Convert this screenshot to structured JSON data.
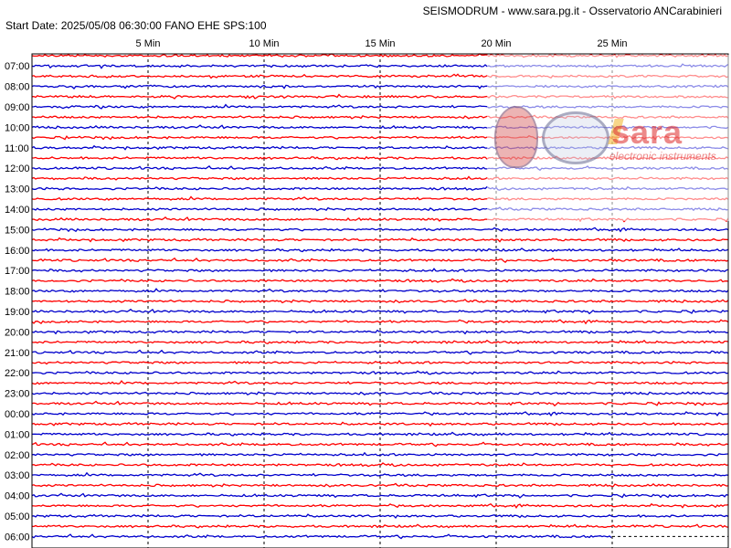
{
  "header": {
    "title": "SEISMODRUM - www.sara.pg.it - Osservatorio ANCarabinieri",
    "start_line": "Start Date: 2025/05/08 06:30:00 FANO   EHE  SPS:100"
  },
  "watermark": {
    "logo_text": "sara",
    "logo_sub": "electronic instruments"
  },
  "colors": {
    "trace_a": "#ff0000",
    "trace_b": "#0000cc",
    "grid": "#000000",
    "frame": "#000000"
  },
  "chart_data": {
    "type": "line",
    "title": "",
    "xlabel": "",
    "ylabel": "",
    "x_ticks": [
      "5 Min",
      "10 Min",
      "15 Min",
      "20 Min",
      "25 Min"
    ],
    "x_tick_minutes": [
      5,
      10,
      15,
      20,
      25
    ],
    "x_range_minutes": [
      0,
      30
    ],
    "rows_per_hour": 2,
    "hour_labels": [
      "07:00",
      "08:00",
      "09:00",
      "10:00",
      "11:00",
      "12:00",
      "13:00",
      "14:00",
      "15:00",
      "16:00",
      "17:00",
      "18:00",
      "19:00",
      "20:00",
      "21:00",
      "22:00",
      "23:00",
      "00:00",
      "01:00",
      "02:00",
      "03:00",
      "04:00",
      "05:00",
      "06:00"
    ],
    "trace_colors_order": [
      "red",
      "blue"
    ],
    "last_trace_end_minute": 25,
    "grid": "vertical dashed at tick minutes"
  }
}
